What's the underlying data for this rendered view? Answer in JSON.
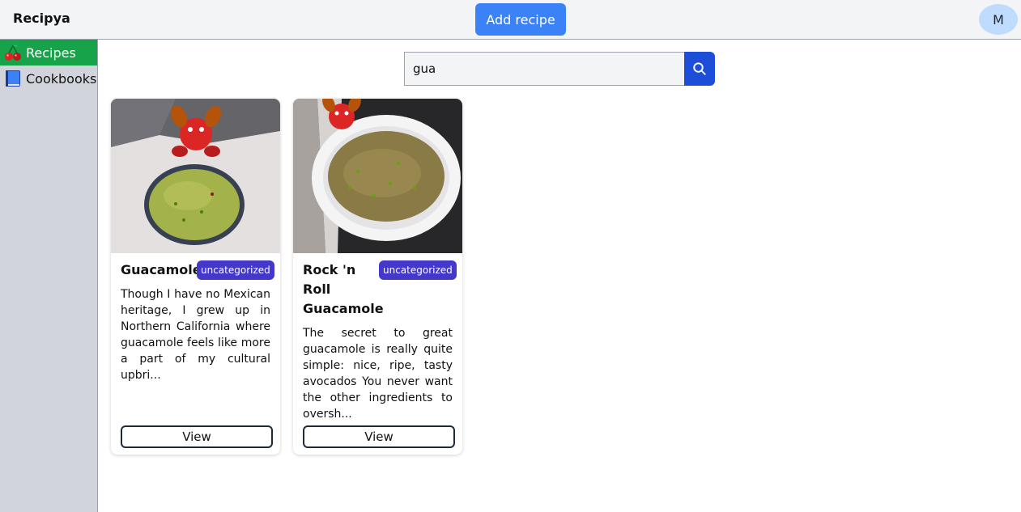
{
  "header": {
    "brand": "Recipya",
    "add_recipe_label": "Add recipe",
    "avatar_initial": "M"
  },
  "sidebar": {
    "items": [
      {
        "label": "Recipes",
        "icon": "cherries-icon",
        "active": true
      },
      {
        "label": "Cookbooks",
        "icon": "book-icon",
        "active": false
      }
    ]
  },
  "search": {
    "value": "gua",
    "button_icon": "search-icon"
  },
  "cards": [
    {
      "title": "Guacamole",
      "category": "uncategorized",
      "description": "Though I have no Mexican heritage, I grew up in Northern California where guacamole feels like more a part of my cultural upbri...",
      "view_label": "View"
    },
    {
      "title": "Rock 'n Roll Guacamole",
      "category": "uncategorized",
      "description": "The secret to great guacamole is really quite simple: nice, ripe, tasty avocados You never want the other ingredients to oversh...",
      "view_label": "View"
    }
  ],
  "colors": {
    "accent": "#3b82f6",
    "active_nav": "#16a34a",
    "badge": "#4338ca",
    "search_button": "#1d4ed8"
  }
}
